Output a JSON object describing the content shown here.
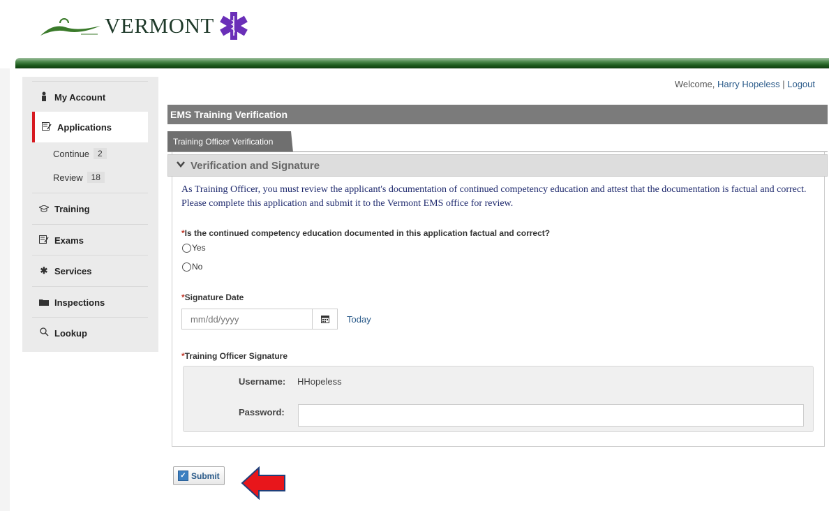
{
  "header": {
    "logo_text": "VERMONT"
  },
  "sidebar": {
    "items": [
      {
        "label": "My Account",
        "icon": "person-icon"
      },
      {
        "label": "Applications",
        "icon": "edit-icon",
        "active": true
      },
      {
        "label": "Training",
        "icon": "mortarboard-icon"
      },
      {
        "label": "Exams",
        "icon": "edit-icon"
      },
      {
        "label": "Services",
        "icon": "asterisk-icon"
      },
      {
        "label": "Inspections",
        "icon": "folder-icon"
      },
      {
        "label": "Lookup",
        "icon": "search-icon"
      }
    ],
    "sub_items": [
      {
        "label": "Continue",
        "count": "2"
      },
      {
        "label": "Review",
        "count": "18"
      }
    ]
  },
  "topbar": {
    "welcome": "Welcome,",
    "user": "Harry Hopeless",
    "separator": "|",
    "logout": "Logout"
  },
  "page_title": "EMS Training Verification",
  "tab": "Training Officer Verification",
  "section_title": "Verification and Signature",
  "description": "As Training Officer, you must review the applicant's documentation of continued competency education and attest that the documentation is factual and correct. Please complete this application and submit it to the Vermont EMS office for review.",
  "question": {
    "required_mark": "*",
    "label": "Is the continued competency education documented in this application factual and correct?",
    "options": [
      "Yes",
      "No"
    ]
  },
  "signature_date": {
    "required_mark": "*",
    "label": "Signature Date",
    "placeholder": "mm/dd/yyyy",
    "today": "Today"
  },
  "signature": {
    "required_mark": "*",
    "label": "Training Officer Signature",
    "username_label": "Username:",
    "username_value": "HHopeless",
    "password_label": "Password:"
  },
  "submit_label": "Submit",
  "colors": {
    "accent_red": "#d71920",
    "link_blue": "#2b5b8a",
    "text_navy": "#1f2a6e",
    "header_green": "#1c5a1c",
    "star_purple": "#6a2fb8"
  }
}
